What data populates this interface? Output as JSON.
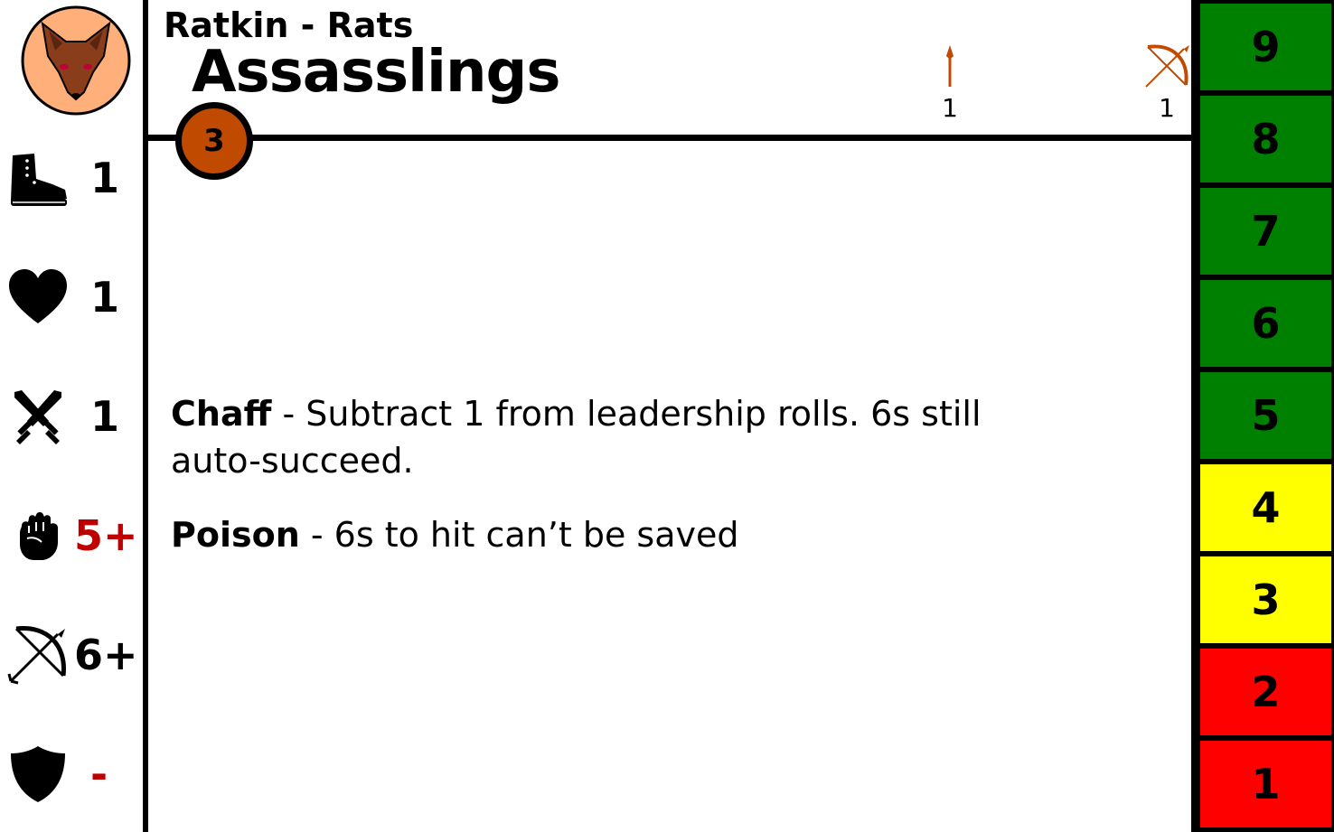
{
  "header": {
    "faction": "Ratkin - Rats",
    "unit_name": "Assasslings",
    "cost": "3"
  },
  "weapons": [
    {
      "icon": "spear-icon",
      "count": "1"
    },
    {
      "icon": "bow-icon",
      "count": "1"
    }
  ],
  "stats": [
    {
      "icon": "boot-icon",
      "value": "1"
    },
    {
      "icon": "heart-icon",
      "value": "1"
    },
    {
      "icon": "crossed-swords-icon",
      "value": "1"
    },
    {
      "icon": "fist-icon",
      "value": "5+"
    },
    {
      "icon": "bow-icon",
      "value": "6+"
    },
    {
      "icon": "shield-icon",
      "value": "-"
    }
  ],
  "rules": [
    {
      "name": "Chaff",
      "text": " - Subtract 1 from leadership rolls. 6s still auto-succeed."
    },
    {
      "name": "Poison",
      "text": " - 6s to hit can’t be saved"
    }
  ],
  "tracker": [
    {
      "label": "9",
      "color": "#008000"
    },
    {
      "label": "8",
      "color": "#008000"
    },
    {
      "label": "7",
      "color": "#008000"
    },
    {
      "label": "6",
      "color": "#008000"
    },
    {
      "label": "5",
      "color": "#008000"
    },
    {
      "label": "4",
      "color": "#ffff00"
    },
    {
      "label": "3",
      "color": "#ffff00"
    },
    {
      "label": "2",
      "color": "#ff0000"
    },
    {
      "label": "1",
      "color": "#ff0000"
    }
  ],
  "colors": {
    "accent": "#c04a00",
    "logo_fill": "#ffb07a",
    "highlight_value": "#c00000"
  }
}
